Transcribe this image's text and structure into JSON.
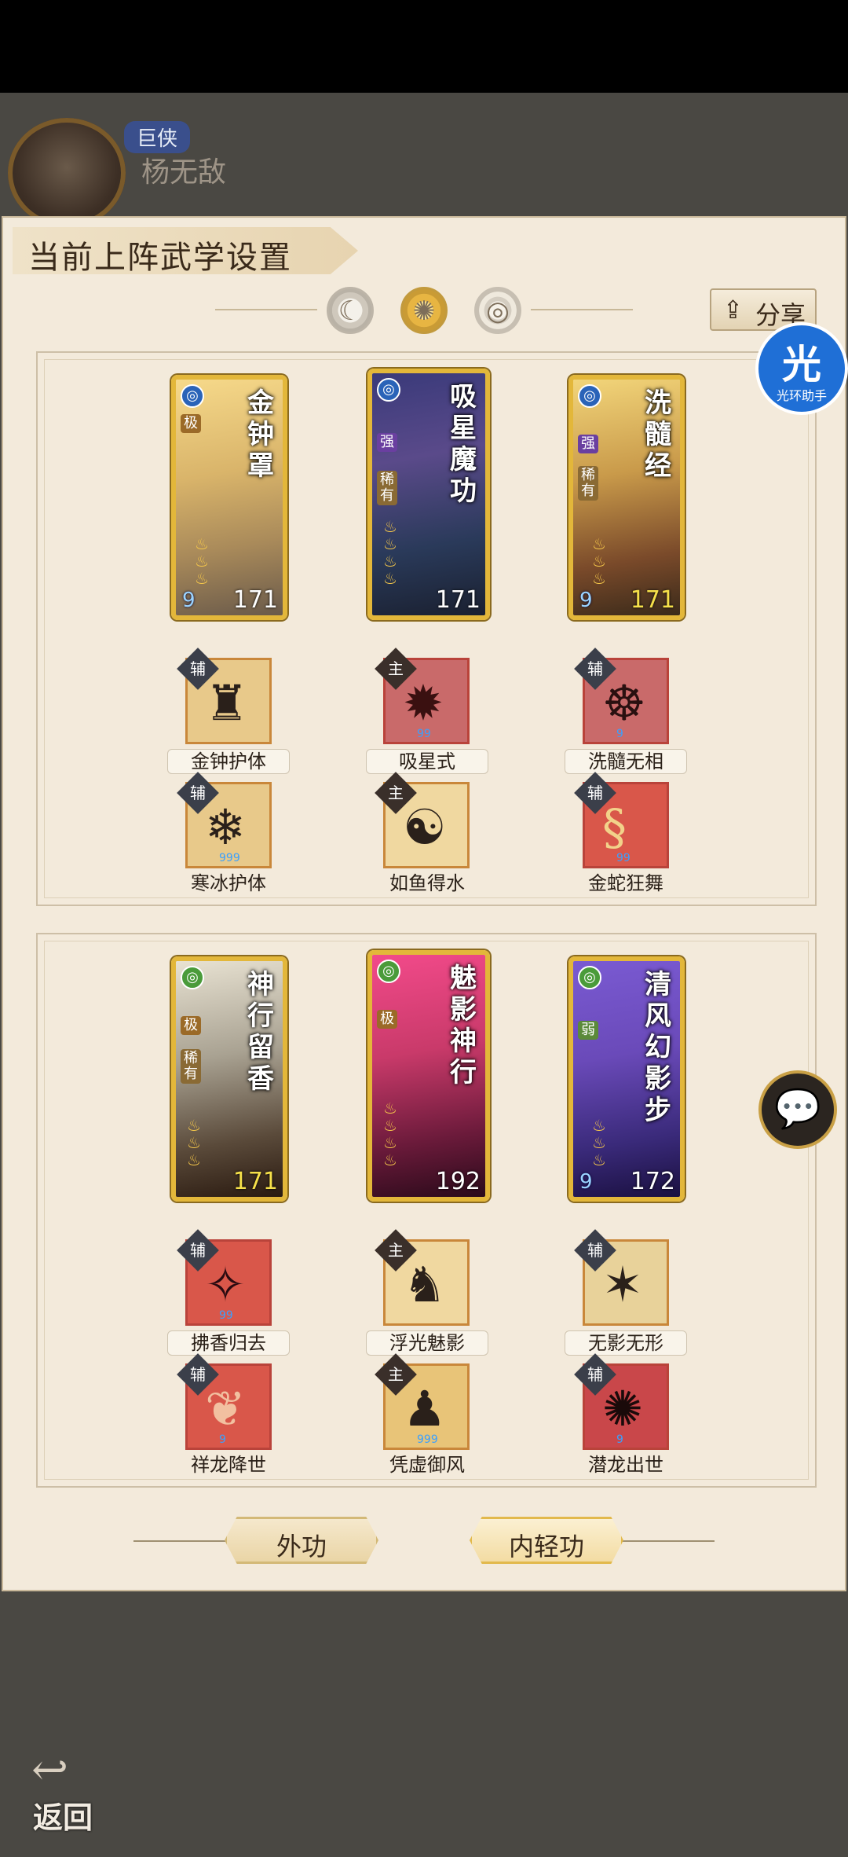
{
  "player": {
    "rank": "巨侠",
    "name": "杨无敌"
  },
  "panel": {
    "title": "当前上阵武学设置",
    "share_label": "分享",
    "share_icon": "share-icon"
  },
  "tabs": [
    {
      "icon": "moon-icon",
      "glyph": "☾"
    },
    {
      "icon": "sun-icon",
      "glyph": "✺"
    },
    {
      "icon": "ring-icon",
      "glyph": "◎"
    }
  ],
  "group1": {
    "cards": [
      {
        "name": "金钟罩",
        "tags": [
          "极"
        ],
        "school": "blue",
        "nine": "9",
        "level": "171",
        "level_color": "#ffffff"
      },
      {
        "name": "吸星魔功",
        "tags": [
          "强",
          "稀有"
        ],
        "school": "blue",
        "nine": "",
        "level": "171",
        "level_color": "#ffffff"
      },
      {
        "name": "洗髓经",
        "tags": [
          "强",
          "稀有"
        ],
        "school": "blue",
        "nine": "9",
        "level": "171",
        "level_color": "#f6e04a"
      }
    ],
    "skills_row1": [
      {
        "badge": "辅",
        "label": "金钟护体"
      },
      {
        "badge": "主",
        "label": "吸星式"
      },
      {
        "badge": "辅",
        "label": "洗髓无相"
      }
    ],
    "skills_row2": [
      {
        "badge": "辅",
        "label": "寒冰护体"
      },
      {
        "badge": "主",
        "label": "如鱼得水"
      },
      {
        "badge": "辅",
        "label": "金蛇狂舞"
      }
    ]
  },
  "group2": {
    "cards": [
      {
        "name": "神行留香",
        "tags": [
          "极",
          "稀有"
        ],
        "school": "green",
        "nine": "",
        "level": "171",
        "level_color": "#f6e04a"
      },
      {
        "name": "魅影神行",
        "tags": [
          "极"
        ],
        "school": "green",
        "nine": "",
        "level": "192",
        "level_color": "#ffffff"
      },
      {
        "name": "清风幻影步",
        "tags": [
          "弱"
        ],
        "school": "green",
        "nine": "9",
        "level": "172",
        "level_color": "#ffffff"
      }
    ],
    "skills_row1": [
      {
        "badge": "辅",
        "label": "拂香归去"
      },
      {
        "badge": "主",
        "label": "浮光魅影"
      },
      {
        "badge": "辅",
        "label": "无影无形"
      }
    ],
    "skills_row2": [
      {
        "badge": "辅",
        "label": "祥龙降世"
      },
      {
        "badge": "主",
        "label": "凭虚御风"
      },
      {
        "badge": "辅",
        "label": "潜龙出世"
      }
    ]
  },
  "bottom_tabs": {
    "outer": "外功",
    "inner": "内轻功"
  },
  "helper": {
    "big": "光",
    "small": "光环助手"
  },
  "chat_icon": "chat-bubble-icon",
  "back_label": "返回"
}
